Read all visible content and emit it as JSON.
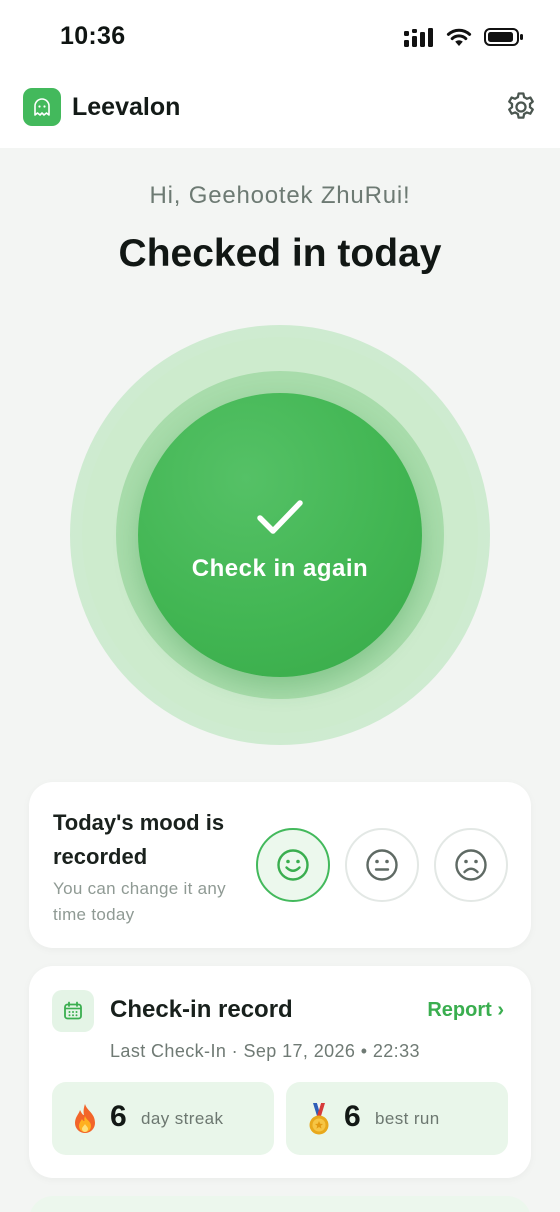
{
  "status_bar": {
    "time": "10:36"
  },
  "header": {
    "app_name": "Leevalon"
  },
  "greeting": "Hi, Geehootek ZhuRui!",
  "status_title": "Checked in today",
  "checkin_button": {
    "label": "Check in again"
  },
  "mood": {
    "title": "Today's mood is recorded",
    "subtitle": "You can change it any time today",
    "options": [
      {
        "name": "happy",
        "selected": true
      },
      {
        "name": "neutral",
        "selected": false
      },
      {
        "name": "sad",
        "selected": false
      }
    ]
  },
  "record": {
    "title": "Check-in record",
    "report_link": "Report ›",
    "last_checkin": "Last Check-In · Sep 17, 2026 • 22:33",
    "streak": {
      "value": "6",
      "label": "day streak"
    },
    "best": {
      "value": "6",
      "label": "best run"
    }
  },
  "colors": {
    "accent": "#43b95c",
    "accent_text": "#3aae4f",
    "background": "#f3f5f3"
  }
}
